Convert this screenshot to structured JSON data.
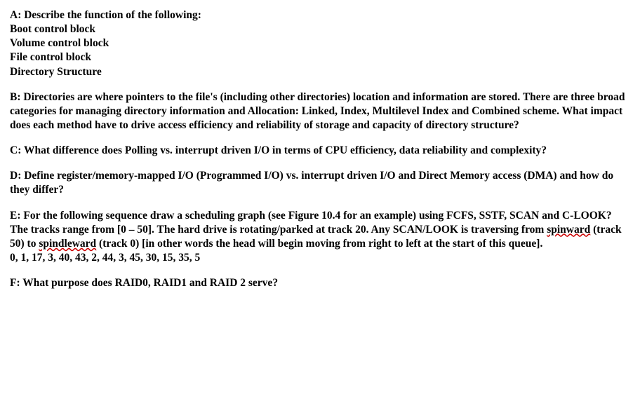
{
  "sectionA": {
    "prompt": "A:  Describe the function of the following:",
    "items": [
      "Boot control block",
      "Volume control block",
      "File control block",
      "Directory Structure"
    ]
  },
  "sectionB": {
    "text": "B: Directories are where pointers to the file's (including other directories) location and information are stored.   There are three broad categories for managing directory information and Allocation: Linked, Index, Multilevel Index and Combined scheme.   What impact does each method have to drive access efficiency and reliability of storage and capacity of directory structure?"
  },
  "sectionC": {
    "text": "C:  What difference does Polling vs. interrupt driven I/O in terms of CPU efficiency, data reliability and complexity?"
  },
  "sectionD": {
    "text": "D:  Define register/memory-mapped I/O (Programmed I/O) vs. interrupt driven I/O  and Direct Memory access  (DMA) and how do they differ?"
  },
  "sectionE": {
    "part1": "E:  For the following sequence draw a scheduling graph (see Figure 10.4 for an example) using FCFS, SSTF, SCAN and C-LOOK?   The tracks range from [0 – 50].  The hard drive is rotating/parked at track 20.   Any SCAN/LOOK is traversing from ",
    "wavy1": "spinward",
    "part2": " (track 50) to ",
    "wavy2": "spindleward",
    "part3": " (track 0) [in other words the head will begin moving from right to left at the start of this queue].",
    "sequence": "0, 1, 17, 3, 40, 43, 2, 44, 3, 45, 30, 15, 35, 5"
  },
  "sectionF": {
    "text": "F:  What purpose does RAID0, RAID1 and RAID 2 serve?"
  }
}
